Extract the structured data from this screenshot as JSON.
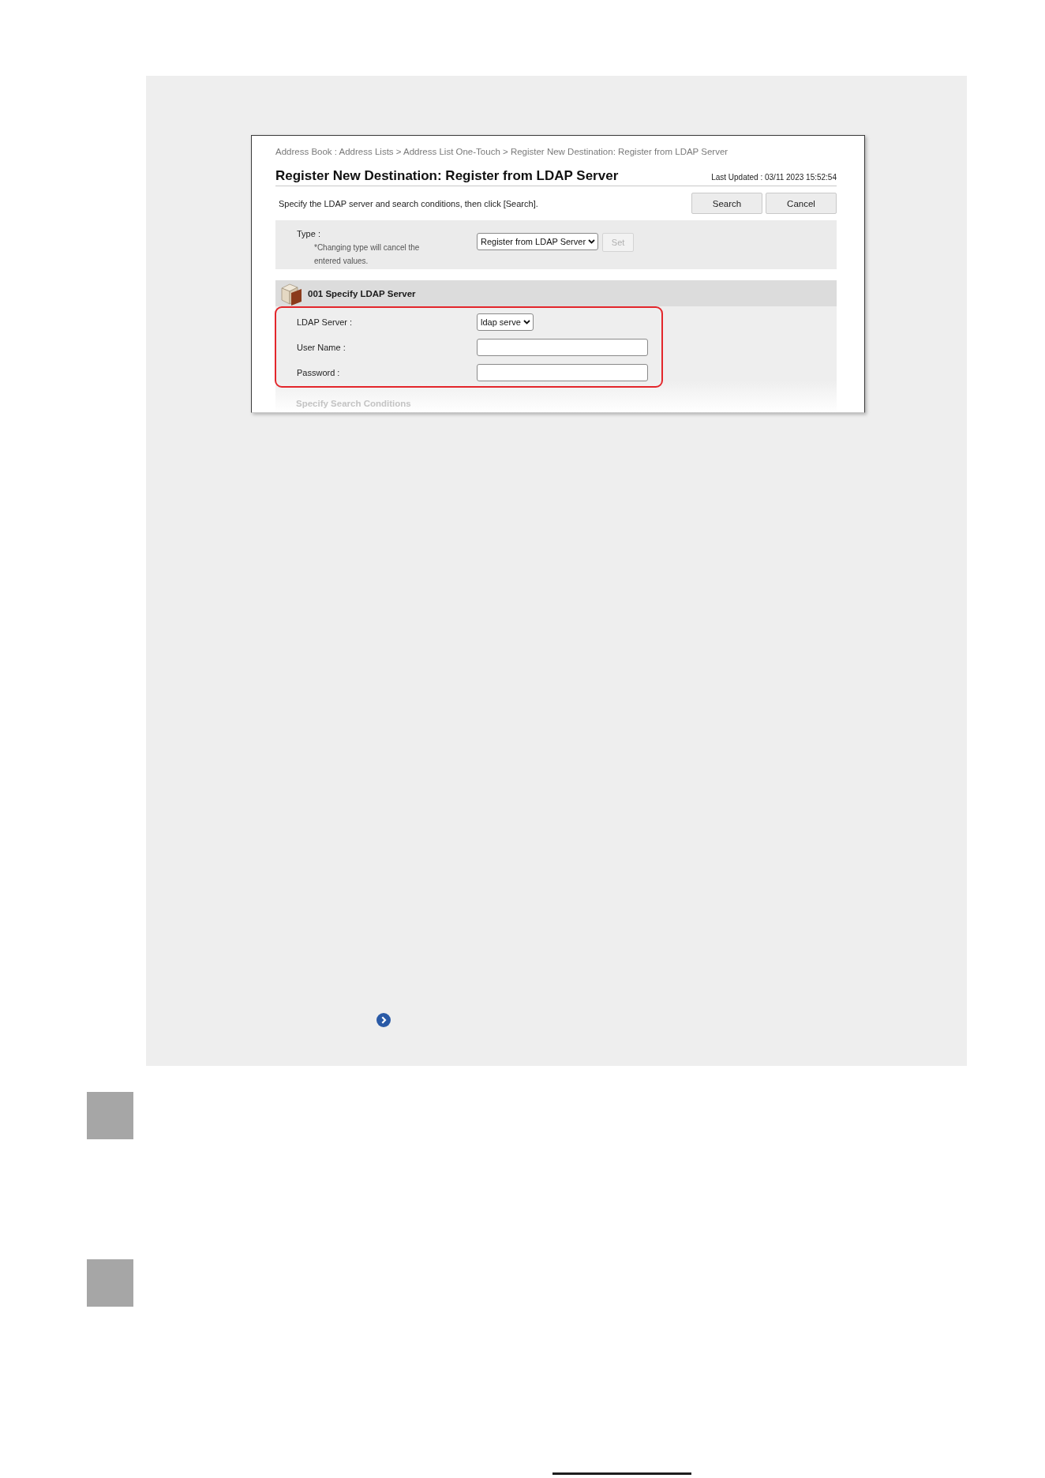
{
  "screenshot": {
    "breadcrumb": "Address Book : Address Lists > Address List One-Touch > Register New Destination: Register from LDAP Server",
    "title": "Register New Destination: Register from LDAP Server",
    "last_updated": "Last Updated : 03/11 2023 15:52:54",
    "description": "Specify the LDAP server and search conditions, then click [Search].",
    "buttons": [
      "Search",
      "Cancel"
    ],
    "type_row": {
      "label": "Type :",
      "note": "*Changing type will cancel the entered values.",
      "select_value": "Register from LDAP Server",
      "set_button": {
        "label": "Set",
        "disabled": true
      }
    },
    "section": {
      "title": "001 Specify LDAP Server",
      "highlighted": true,
      "fields": [
        {
          "kind": "select",
          "label": "LDAP Server :",
          "value": "ldap serve"
        },
        {
          "kind": "input",
          "label": "User Name :"
        },
        {
          "kind": "input",
          "label": "Password :"
        }
      ]
    },
    "next_section": "Specify Search Conditions"
  }
}
